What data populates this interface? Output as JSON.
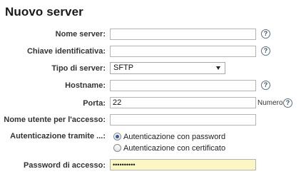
{
  "page": {
    "title": "Nuovo server"
  },
  "form": {
    "server_name": {
      "label": "Nome server:",
      "value": ""
    },
    "key": {
      "label": "Chiave identificativa:",
      "value": ""
    },
    "server_type": {
      "label": "Tipo di server:",
      "selected": "SFTP"
    },
    "hostname": {
      "label": "Hostname:",
      "value": ""
    },
    "port": {
      "label": "Porta:",
      "value": "22",
      "unit": "Numero"
    },
    "username": {
      "label": "Nome utente per l'accesso:",
      "value": ""
    },
    "auth": {
      "label": "Autenticazione tramite ...:",
      "options": [
        {
          "label": "Autenticazione con password",
          "checked": true
        },
        {
          "label": "Autenticazione con certificato",
          "checked": false
        }
      ]
    },
    "password": {
      "label": "Password di accesso:",
      "value": "••••••••••"
    }
  },
  "icons": {
    "help": "help-icon",
    "help_glyph": "?"
  },
  "colors": {
    "password_bg": "#fbf7c3",
    "radio_selected": "#2a5fb0"
  }
}
